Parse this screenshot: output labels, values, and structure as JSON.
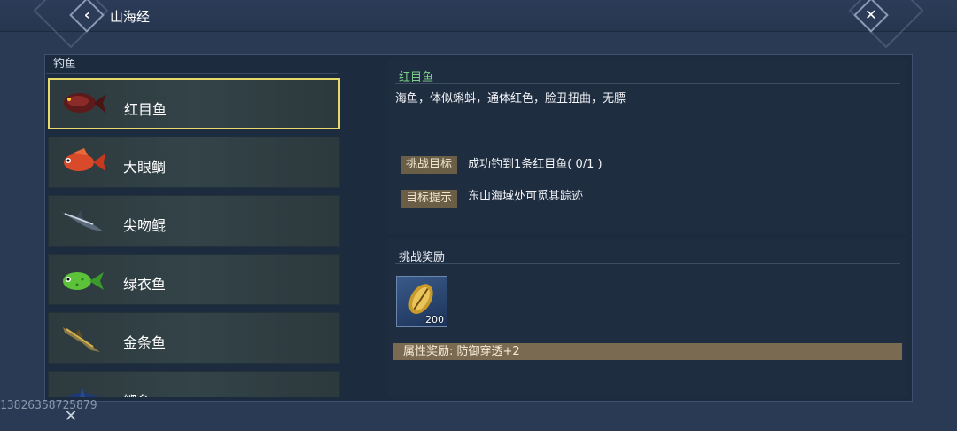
{
  "header": {
    "title": "山海经"
  },
  "list": {
    "title": "钓鱼",
    "items": [
      {
        "name": "红目鱼",
        "icon": "red-eye-fish-icon",
        "selected": true
      },
      {
        "name": "大眼鲷",
        "icon": "bigeye-snapper-icon",
        "selected": false
      },
      {
        "name": "尖吻鲲",
        "icon": "pointed-snout-fish-icon",
        "selected": false
      },
      {
        "name": "绿衣鱼",
        "icon": "green-fish-icon",
        "selected": false
      },
      {
        "name": "金条鱼",
        "icon": "golden-stripe-fish-icon",
        "selected": false
      },
      {
        "name": "鲣鱼",
        "icon": "bonito-icon",
        "selected": false
      }
    ]
  },
  "detail": {
    "name": "红目鱼",
    "description": "海鱼，体似蝌蚪，通体红色，脸丑扭曲，无膘",
    "goal_label": "挑战目标",
    "goal_text": "成功钓到1条红目鱼( 0/1 )",
    "hint_label": "目标提示",
    "hint_text": "东山海域处可觅其踪迹"
  },
  "reward": {
    "title": "挑战奖励",
    "item_icon": "cowrie-shell-icon",
    "item_count": "200",
    "attribute": "属性奖励: 防御穿透+2"
  },
  "footer": {
    "id_text": "13826358725879"
  },
  "colors": {
    "selected_border": "#e9d96b",
    "fish_name_green": "#7ed08a",
    "tag_bg": "#6a5e47"
  }
}
